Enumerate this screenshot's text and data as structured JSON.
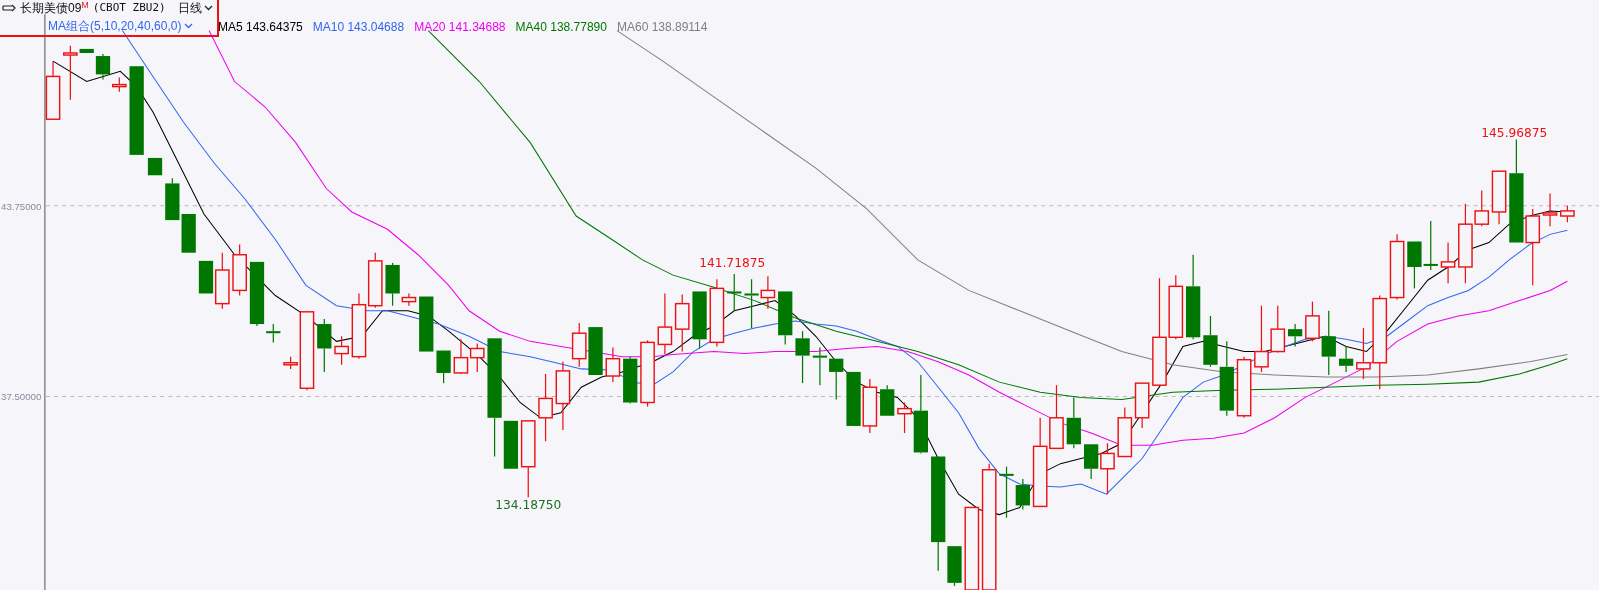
{
  "header": {
    "title": "长期美债09",
    "title_mark": "M",
    "code": "(CBOT ZBU2)",
    "period": "日线",
    "highlighted": true
  },
  "ma_selector": "MA组合(5,10,20,40,60,0)",
  "ma_values": [
    {
      "label": "MA5 143.64375",
      "color": "#000000"
    },
    {
      "label": "MA10 143.04688",
      "color": "#3366ee"
    },
    {
      "label": "MA20 141.34688",
      "color": "#ee00ee"
    },
    {
      "label": "MA40 138.77890",
      "color": "#007700"
    },
    {
      "label": "MA60 138.89114",
      "color": "#808080"
    }
  ],
  "chart": {
    "yticks": [
      "43.75000",
      "37.50000"
    ],
    "annotations": [
      {
        "text": "141.71875",
        "kind": "high"
      },
      {
        "text": "134.18750",
        "kind": "low"
      },
      {
        "text": "145.96875",
        "kind": "high"
      }
    ]
  }
}
